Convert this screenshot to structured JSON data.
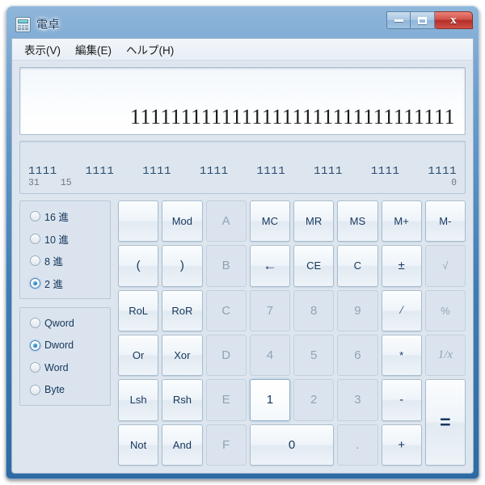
{
  "window": {
    "title": "電卓",
    "icon": "calculator-icon",
    "caption": {
      "minimize": "minimize-icon",
      "maximize": "maximize-icon",
      "close": "x"
    }
  },
  "menu": {
    "items": [
      {
        "label": "表示(V)"
      },
      {
        "label": "編集(E)"
      },
      {
        "label": "ヘルプ(H)"
      }
    ]
  },
  "display": {
    "value": "11111111111111111111111111111111"
  },
  "bitmap": {
    "groups": [
      "1111",
      "1111",
      "1111",
      "1111",
      "1111",
      "1111",
      "1111",
      "1111"
    ],
    "label_high": "31",
    "label_mid": "15",
    "label_low": "0"
  },
  "bases": {
    "options": [
      {
        "label": "16 進",
        "checked": false
      },
      {
        "label": "10 進",
        "checked": false
      },
      {
        "label": "8 進",
        "checked": false
      },
      {
        "label": "2 進",
        "checked": true
      }
    ]
  },
  "word_sizes": {
    "options": [
      {
        "label": "Qword",
        "checked": false
      },
      {
        "label": "Dword",
        "checked": true
      },
      {
        "label": "Word",
        "checked": false
      },
      {
        "label": "Byte",
        "checked": false
      }
    ]
  },
  "keypad": {
    "keys": [
      {
        "label": "",
        "name": "blank-key",
        "state": "blank"
      },
      {
        "label": "Mod",
        "name": "mod-button",
        "state": "normal",
        "size": "small"
      },
      {
        "label": "A",
        "name": "hex-a-button",
        "state": "disabled"
      },
      {
        "label": "MC",
        "name": "memory-clear-button",
        "state": "normal",
        "size": "small"
      },
      {
        "label": "MR",
        "name": "memory-recall-button",
        "state": "normal",
        "size": "small"
      },
      {
        "label": "MS",
        "name": "memory-store-button",
        "state": "normal",
        "size": "small"
      },
      {
        "label": "M+",
        "name": "memory-add-button",
        "state": "normal",
        "size": "small"
      },
      {
        "label": "M-",
        "name": "memory-subtract-button",
        "state": "normal",
        "size": "small"
      },
      {
        "label": "(",
        "name": "left-paren-button",
        "state": "normal"
      },
      {
        "label": ")",
        "name": "right-paren-button",
        "state": "normal"
      },
      {
        "label": "B",
        "name": "hex-b-button",
        "state": "disabled"
      },
      {
        "label": "←",
        "name": "backspace-button",
        "state": "normal",
        "size": "arrow"
      },
      {
        "label": "CE",
        "name": "clear-entry-button",
        "state": "normal",
        "size": "small"
      },
      {
        "label": "C",
        "name": "clear-button",
        "state": "normal",
        "size": "small"
      },
      {
        "label": "±",
        "name": "sign-toggle-button",
        "state": "normal"
      },
      {
        "label": "√",
        "name": "square-root-button",
        "state": "disabled",
        "size": "small"
      },
      {
        "label": "RoL",
        "name": "rotate-left-button",
        "state": "normal",
        "size": "small"
      },
      {
        "label": "RoR",
        "name": "rotate-right-button",
        "state": "normal",
        "size": "small"
      },
      {
        "label": "C",
        "name": "hex-c-button",
        "state": "disabled"
      },
      {
        "label": "7",
        "name": "digit-7-button",
        "state": "disabled"
      },
      {
        "label": "8",
        "name": "digit-8-button",
        "state": "disabled"
      },
      {
        "label": "9",
        "name": "digit-9-button",
        "state": "disabled"
      },
      {
        "label": "/",
        "name": "divide-button",
        "state": "normal",
        "size": "italic"
      },
      {
        "label": "%",
        "name": "percent-button",
        "state": "disabled",
        "size": "small"
      },
      {
        "label": "Or",
        "name": "or-button",
        "state": "normal",
        "size": "small"
      },
      {
        "label": "Xor",
        "name": "xor-button",
        "state": "normal",
        "size": "small"
      },
      {
        "label": "D",
        "name": "hex-d-button",
        "state": "disabled"
      },
      {
        "label": "4",
        "name": "digit-4-button",
        "state": "disabled"
      },
      {
        "label": "5",
        "name": "digit-5-button",
        "state": "disabled"
      },
      {
        "label": "6",
        "name": "digit-6-button",
        "state": "disabled"
      },
      {
        "label": "*",
        "name": "multiply-button",
        "state": "normal",
        "size": "small"
      },
      {
        "label": "1/x",
        "name": "reciprocal-button",
        "state": "disabled",
        "size": "italic"
      },
      {
        "label": "Lsh",
        "name": "left-shift-button",
        "state": "normal",
        "size": "small"
      },
      {
        "label": "Rsh",
        "name": "right-shift-button",
        "state": "normal",
        "size": "small"
      },
      {
        "label": "E",
        "name": "hex-e-button",
        "state": "disabled"
      },
      {
        "label": "1",
        "name": "digit-1-button",
        "state": "hover"
      },
      {
        "label": "2",
        "name": "digit-2-button",
        "state": "disabled"
      },
      {
        "label": "3",
        "name": "digit-3-button",
        "state": "disabled"
      },
      {
        "label": "-",
        "name": "subtract-button",
        "state": "normal"
      },
      {
        "label": "=",
        "name": "equals-button",
        "state": "normal",
        "size": "equals",
        "span": "tall"
      },
      {
        "label": "Not",
        "name": "not-button",
        "state": "normal",
        "size": "small"
      },
      {
        "label": "And",
        "name": "and-button",
        "state": "normal",
        "size": "small"
      },
      {
        "label": "F",
        "name": "hex-f-button",
        "state": "disabled"
      },
      {
        "label": "0",
        "name": "digit-0-button",
        "state": "normal",
        "span": "wide"
      },
      {
        "label": ".",
        "name": "decimal-point-button",
        "state": "disabled"
      },
      {
        "label": "+",
        "name": "add-button",
        "state": "normal"
      }
    ]
  }
}
